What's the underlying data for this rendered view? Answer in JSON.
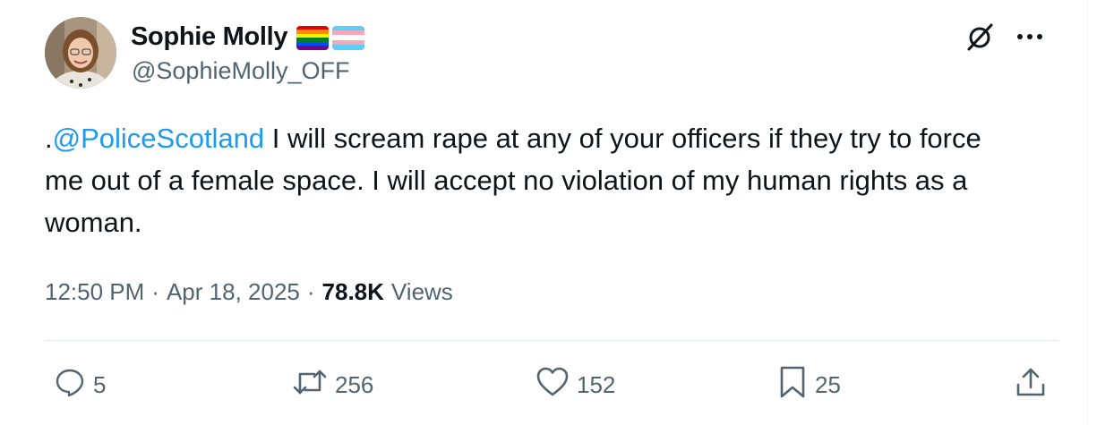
{
  "author": {
    "display_name": "Sophie Molly",
    "handle": "@SophieMolly_OFF",
    "flags": [
      "rainbow-flag-icon",
      "transgender-flag-icon"
    ]
  },
  "tweet": {
    "prefix": ".",
    "mention": "@PoliceScotland",
    "text_after_mention": " I will scream rape at any of your officers if they try to force me out of a female space. I will accept no violation of my human rights as a woman."
  },
  "meta": {
    "time": "12:50 PM",
    "separator": "·",
    "date": "Apr 18, 2025",
    "views_count": "78.8K",
    "views_label": "Views"
  },
  "actions": {
    "replies": "5",
    "reposts": "256",
    "likes": "152",
    "bookmarks": "25"
  },
  "colors": {
    "accent": "#1d9bf0",
    "text": "#0f1419",
    "secondary": "#536471"
  }
}
